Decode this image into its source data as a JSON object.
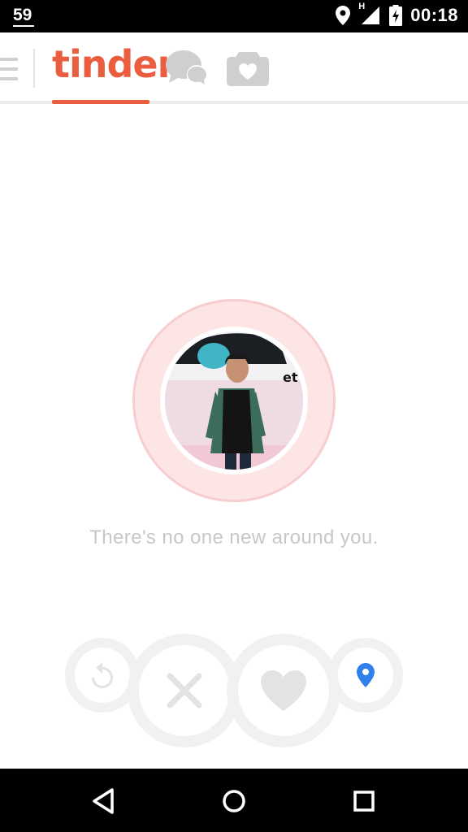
{
  "status_bar": {
    "notification_count": "59",
    "network_type": "H",
    "time": "00:18"
  },
  "header": {
    "logo_text": "tinder"
  },
  "discovery": {
    "empty_message": "There's no one new around you."
  },
  "colors": {
    "brand": "#ea5d3f",
    "radar_fill": "#fde5e6",
    "location_blue": "#2f80ed",
    "muted_icon": "#cfcfcf"
  },
  "icons": {
    "menu": "hamburger-menu-icon",
    "chat": "chat-bubbles-icon",
    "moments": "camera-heart-icon",
    "rewind": "rewind-icon",
    "nope": "x-icon",
    "like": "heart-icon",
    "location": "location-pin-icon"
  }
}
